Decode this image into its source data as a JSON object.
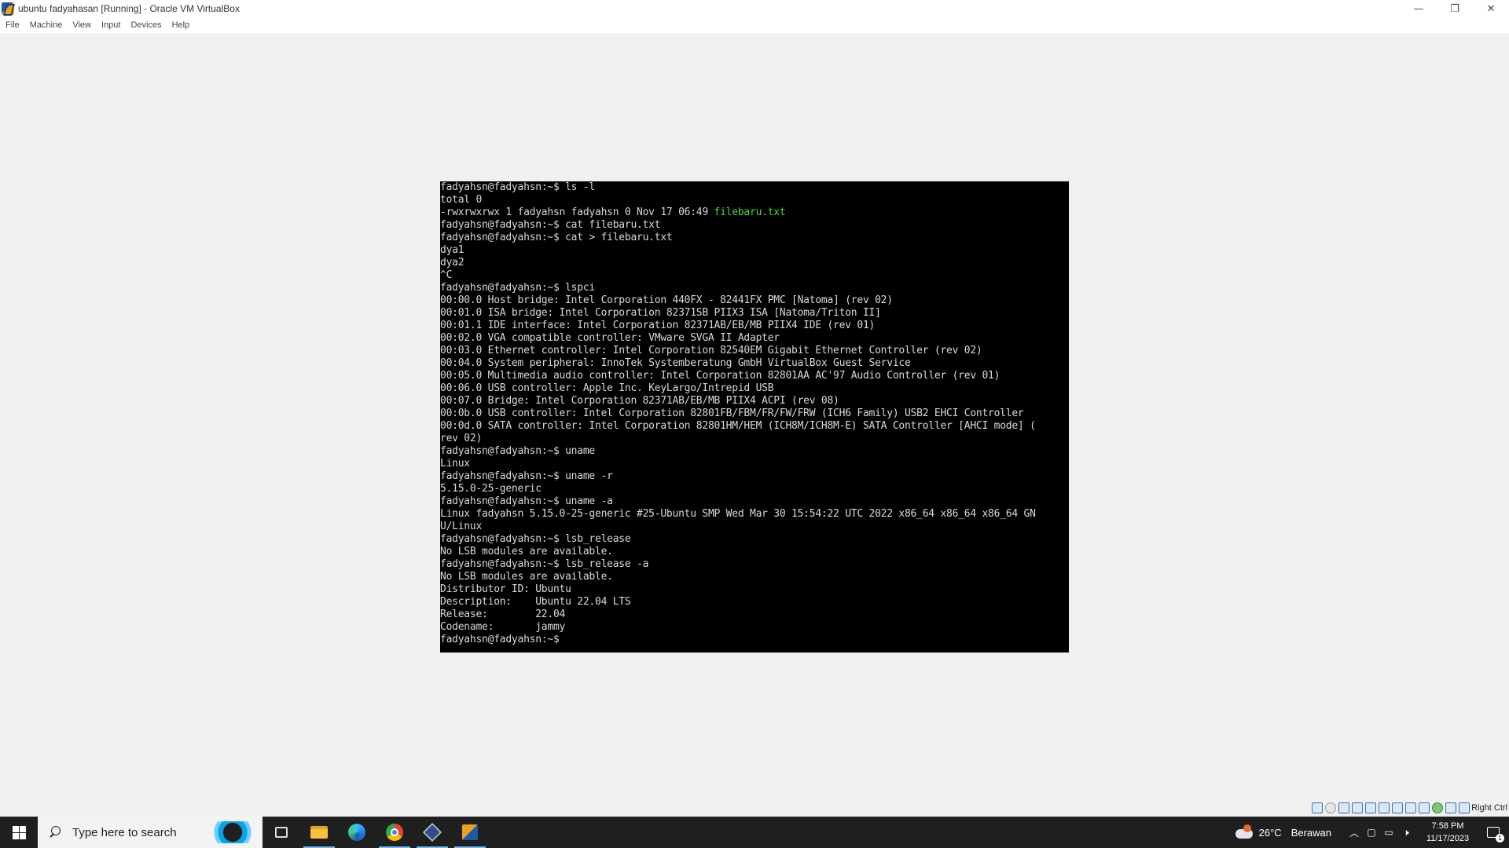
{
  "window": {
    "title": "ubuntu fadyahasan [Running] - Oracle VM VirtualBox",
    "minimize_glyph": "—",
    "restore_glyph": "❐",
    "close_glyph": "✕"
  },
  "menubar": {
    "items": [
      "File",
      "Machine",
      "View",
      "Input",
      "Devices",
      "Help"
    ]
  },
  "terminal": {
    "lines": [
      "fadyahsn@fadyahsn:~$ ls -l",
      "total 0",
      "-rwxrwxrwx 1 fadyahsn fadyahsn 0 Nov 17 06:49 ",
      "fadyahsn@fadyahsn:~$ cat filebaru.txt",
      "fadyahsn@fadyahsn:~$ cat > filebaru.txt",
      "dya1",
      "dya2",
      "^C",
      "fadyahsn@fadyahsn:~$ lspci",
      "00:00.0 Host bridge: Intel Corporation 440FX - 82441FX PMC [Natoma] (rev 02)",
      "00:01.0 ISA bridge: Intel Corporation 82371SB PIIX3 ISA [Natoma/Triton II]",
      "00:01.1 IDE interface: Intel Corporation 82371AB/EB/MB PIIX4 IDE (rev 01)",
      "00:02.0 VGA compatible controller: VMware SVGA II Adapter",
      "00:03.0 Ethernet controller: Intel Corporation 82540EM Gigabit Ethernet Controller (rev 02)",
      "00:04.0 System peripheral: InnoTek Systemberatung GmbH VirtualBox Guest Service",
      "00:05.0 Multimedia audio controller: Intel Corporation 82801AA AC'97 Audio Controller (rev 01)",
      "00:06.0 USB controller: Apple Inc. KeyLargo/Intrepid USB",
      "00:07.0 Bridge: Intel Corporation 82371AB/EB/MB PIIX4 ACPI (rev 08)",
      "00:0b.0 USB controller: Intel Corporation 82801FB/FBM/FR/FW/FRW (ICH6 Family) USB2 EHCI Controller",
      "00:0d.0 SATA controller: Intel Corporation 82801HM/HEM (ICH8M/ICH8M-E) SATA Controller [AHCI mode] (",
      "rev 02)",
      "fadyahsn@fadyahsn:~$ uname",
      "Linux",
      "fadyahsn@fadyahsn:~$ uname -r",
      "5.15.0-25-generic",
      "fadyahsn@fadyahsn:~$ uname -a",
      "Linux fadyahsn 5.15.0-25-generic #25-Ubuntu SMP Wed Mar 30 15:54:22 UTC 2022 x86_64 x86_64 x86_64 GN",
      "U/Linux",
      "fadyahsn@fadyahsn:~$ lsb_release",
      "No LSB modules are available.",
      "fadyahsn@fadyahsn:~$ lsb_release -a",
      "No LSB modules are available.",
      "Distributor ID: Ubuntu",
      "Description:    Ubuntu 22.04 LTS",
      "Release:        22.04",
      "Codename:       jammy",
      "fadyahsn@fadyahsn:~$ "
    ],
    "highlight": {
      "line_index": 2,
      "text": "filebaru.txt",
      "color": "#3ee03e"
    }
  },
  "statusbar": {
    "host_key": "Right Ctrl",
    "icons": [
      "hard-disk-icon",
      "optical-drive-icon",
      "audio-icon",
      "network-icon",
      "usb-icon",
      "shared-folders-icon",
      "display-icon",
      "recording-icon",
      "cpu-icon",
      "guest-additions-icon",
      "mouse-integration-icon",
      "keyboard-icon"
    ]
  },
  "taskbar": {
    "search_placeholder": "Type here to search",
    "apps": [
      "task-view-icon",
      "file-explorer-icon",
      "edge-icon",
      "chrome-icon",
      "virtualbox-manager-icon",
      "virtualbox-vm-icon"
    ],
    "weather_temp": "26°C",
    "weather_condition": "Berawan",
    "time": "7:58 PM",
    "date": "11/17/2023",
    "notification_count": "1"
  }
}
